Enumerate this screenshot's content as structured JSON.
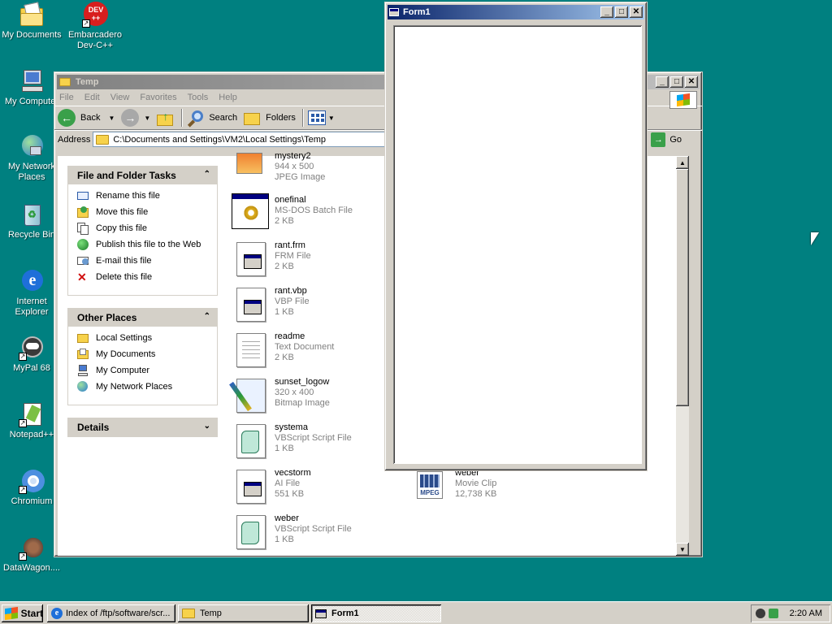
{
  "desktop": {
    "icons": [
      {
        "label": "My Documents",
        "icon": "my-documents-icon"
      },
      {
        "label": "Embarcadero Dev-C++",
        "label1": "Embarcadero",
        "label2": "Dev-C++",
        "icon": "devcpp-icon",
        "badge": "DEV ++"
      },
      {
        "label": "My Computer",
        "icon": "my-computer-icon"
      },
      {
        "label1": "My Network",
        "label2": "Places",
        "icon": "my-network-places-icon"
      },
      {
        "label": "Recycle Bin",
        "icon": "recycle-bin-icon"
      },
      {
        "label1": "Internet",
        "label2": "Explorer",
        "icon": "internet-explorer-icon"
      },
      {
        "label": "MyPal 68",
        "icon": "mypal-icon"
      },
      {
        "label": "Notepad++",
        "icon": "notepadpp-icon"
      },
      {
        "label": "Chromium",
        "icon": "chromium-icon"
      },
      {
        "label": "DataWagon....",
        "icon": "datawagon-icon"
      }
    ]
  },
  "explorer": {
    "title": "Temp",
    "menu": [
      "File",
      "Edit",
      "View",
      "Favorites",
      "Tools",
      "Help"
    ],
    "toolbar": {
      "back": "Back",
      "search": "Search",
      "folders": "Folders"
    },
    "address_label": "Address",
    "address_value": "C:\\Documents and Settings\\VM2\\Local Settings\\Temp",
    "go_label": "Go",
    "file_tasks": {
      "header": "File and Folder Tasks",
      "items": [
        "Rename this file",
        "Move this file",
        "Copy this file",
        "Publish this file to the Web",
        "E-mail this file",
        "Delete this file"
      ]
    },
    "other_places": {
      "header": "Other Places",
      "items": [
        "Local Settings",
        "My Documents",
        "My Computer",
        "My Network Places"
      ]
    },
    "details": {
      "header": "Details"
    },
    "files": [
      {
        "name": "mystery2",
        "type": "944 x 500",
        "size": "JPEG Image",
        "icon": "jpeg-image-icon"
      },
      {
        "name": "onefinal",
        "type": "MS-DOS Batch File",
        "size": "2 KB",
        "icon": "batch-file-icon"
      },
      {
        "name": "rant.frm",
        "type": "FRM File",
        "size": "2 KB",
        "icon": "vb-form-file-icon"
      },
      {
        "name": "rant.vbp",
        "type": "VBP File",
        "size": "1 KB",
        "icon": "vb-project-file-icon"
      },
      {
        "name": "readme",
        "type": "Text Document",
        "size": "2 KB",
        "icon": "text-document-icon"
      },
      {
        "name": "sunset_logow",
        "type": "320 x 400",
        "size": "Bitmap Image",
        "icon": "bitmap-image-icon"
      },
      {
        "name": "systema",
        "type": "VBScript Script File",
        "size": "1 KB",
        "icon": "vbscript-file-icon"
      },
      {
        "name": "vecstorm",
        "type": "AI File",
        "size": "551 KB",
        "icon": "ai-file-icon"
      },
      {
        "name": "weber",
        "type": "VBScript Script File",
        "size": "1 KB",
        "icon": "vbscript-file-icon"
      }
    ],
    "file_right": {
      "name": "weber",
      "type": "Movie Clip",
      "size": "12,738 KB",
      "icon": "mpeg-movie-icon",
      "badge": "MPEG"
    }
  },
  "form1": {
    "title": "Form1"
  },
  "taskbar": {
    "start": "Start",
    "buttons": [
      {
        "label": "Index of /ftp/software/scr...",
        "icon": "ie-icon"
      },
      {
        "label": "Temp",
        "icon": "folder-icon"
      },
      {
        "label": "Form1",
        "icon": "form-icon"
      }
    ],
    "clock": "2:20 AM"
  }
}
